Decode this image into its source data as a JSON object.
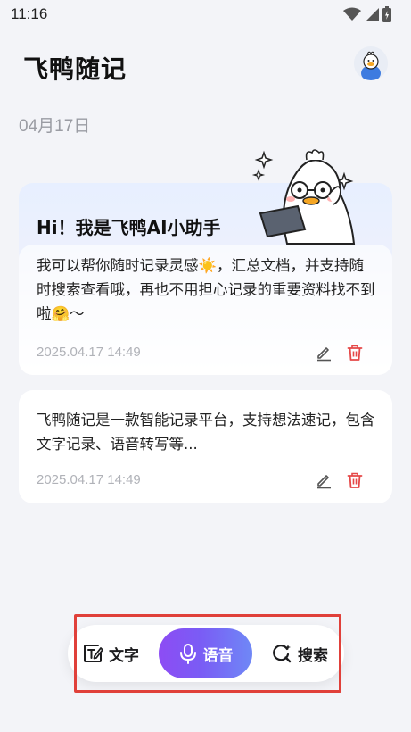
{
  "status_bar": {
    "time": "11:16"
  },
  "header": {
    "title": "飞鸭随记"
  },
  "date_label": "04月17日",
  "assistant_card": {
    "title": "Hi！我是飞鸭AI小助手",
    "text": "我可以帮你随时记录灵感☀️，汇总文档，并支持随时搜索查看哦，再也不用担心记录的重要资料找不到啦🤗～",
    "time": "2025.04.17 14:49"
  },
  "notes": [
    {
      "text": "飞鸭随记是一款智能记录平台，支持想法速记，包含文字记录、语音转写等...",
      "time": "2025.04.17 14:49"
    }
  ],
  "toolbar": {
    "text_label": "文字",
    "voice_label": "语音",
    "search_label": "搜索"
  },
  "colors": {
    "accent_start": "#8d4cf4",
    "accent_end": "#6f88f6",
    "delete": "#e54848",
    "highlight_outline": "#e0403a"
  },
  "icons": [
    "wifi-icon",
    "signal-icon",
    "battery-icon",
    "edit-icon",
    "delete-icon",
    "text-icon",
    "microphone-icon",
    "search-icon"
  ]
}
